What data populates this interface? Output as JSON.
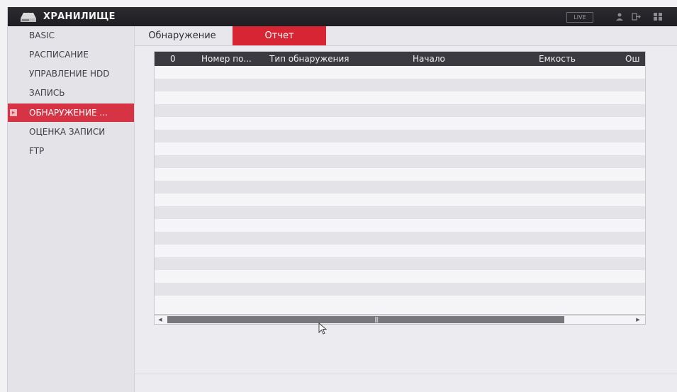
{
  "window": {
    "title": "ХРАНИЛИЩЕ",
    "live_label": "LIVE"
  },
  "sidebar": {
    "items": [
      {
        "label": "BASIC",
        "active": false
      },
      {
        "label": "РАСПИСАНИЕ",
        "active": false
      },
      {
        "label": "УПРАВЛЕНИЕ HDD",
        "active": false
      },
      {
        "label": "ЗАПИСЬ",
        "active": false
      },
      {
        "label": "ОБНАРУЖЕНИЕ ...",
        "active": true
      },
      {
        "label": "ОЦЕНКА ЗАПИСИ",
        "active": false
      },
      {
        "label": "FTP",
        "active": false
      }
    ]
  },
  "tabs": [
    {
      "label": "Обнаружение",
      "active": false
    },
    {
      "label": "Отчет",
      "active": true
    }
  ],
  "table": {
    "columns": [
      "0",
      "Номер по...",
      "Тип обнаружения",
      "Начало",
      "Емкость",
      "Ош"
    ],
    "rows": []
  },
  "colors": {
    "accent": "#d63445",
    "header_bg": "#3a3a40",
    "topbar_bg": "#1d1d22"
  },
  "icons": {
    "logo": "hdd-storage-icon",
    "user": "user-icon",
    "logout": "logout-icon",
    "grid": "grid-icon"
  }
}
